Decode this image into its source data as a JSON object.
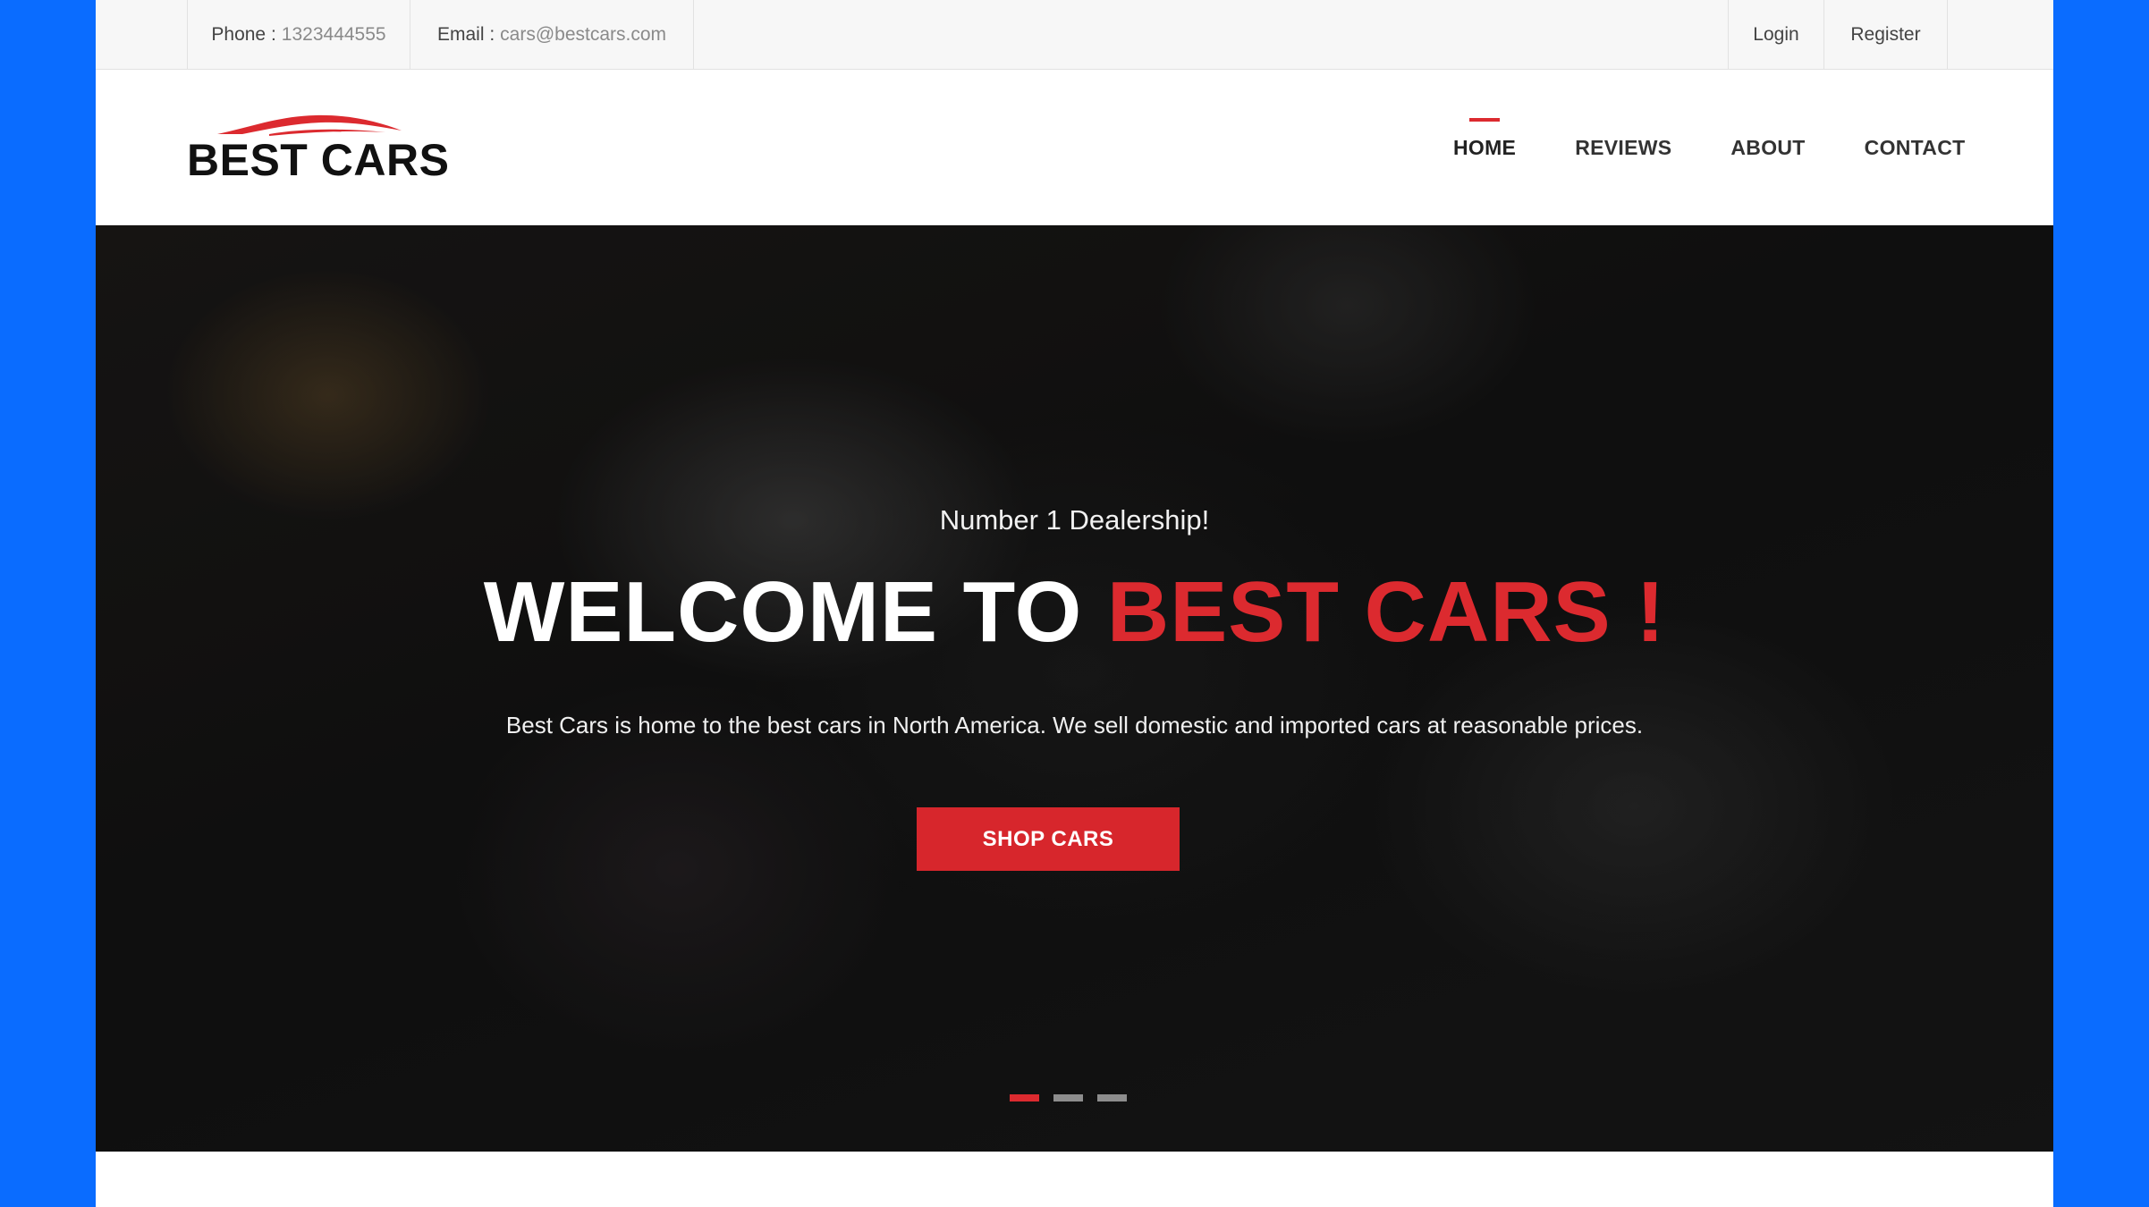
{
  "topbar": {
    "phone_label": "Phone :",
    "phone_value": "1323444555",
    "email_label": "Email :",
    "email_value": "cars@bestcars.com",
    "login": "Login",
    "register": "Register"
  },
  "brand": {
    "logo_text": "BEST CARS",
    "accent_color": "#dc2a2f"
  },
  "nav": {
    "items": [
      {
        "label": "HOME",
        "active": true
      },
      {
        "label": "REVIEWS"
      },
      {
        "label": "ABOUT"
      },
      {
        "label": "CONTACT"
      }
    ]
  },
  "hero": {
    "kicker": "Number 1 Dealership!",
    "title_lead": "WELCOME TO ",
    "title_accent": "BEST CARS !",
    "subtitle": "Best Cars is home to the best cars in North America. We sell domestic and imported cars at reasonable prices.",
    "cta": "SHOP CARS",
    "slides": [
      {
        "active": true
      },
      {
        "active": false
      },
      {
        "active": false
      }
    ]
  }
}
